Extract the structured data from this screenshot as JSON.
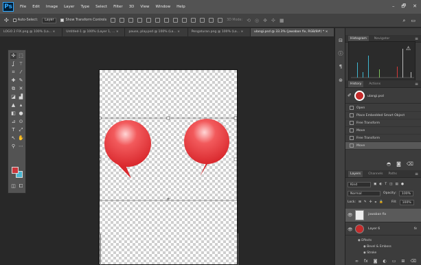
{
  "app": {
    "logo": "Ps",
    "menus": [
      "File",
      "Edit",
      "Image",
      "Layer",
      "Type",
      "Select",
      "Filter",
      "3D",
      "View",
      "Window",
      "Help"
    ],
    "window_controls": [
      "–",
      "🗗",
      "✕"
    ]
  },
  "options": {
    "auto_select": "Auto-Select:",
    "layer_select": "Layer",
    "show_transform": "Show Transform Controls",
    "mode_3d": "3D Mode:"
  },
  "tabs": [
    {
      "label": "LOGO 2 FIX.png @ 100% (La...",
      "close": "×"
    },
    {
      "label": "Untitled-1 @ 100% (Layer 1, ...",
      "close": "×"
    },
    {
      "label": "pause, play.psd @ 100% (La...",
      "close": "×"
    },
    {
      "label": "Pengaturan.png @ 100% (La...",
      "close": "×"
    },
    {
      "label": "ulangi.psd @ 33.3% (jawaban fix, RGB/8#) *",
      "close": "×"
    }
  ],
  "colors": {
    "bubble": "#e8353a",
    "foreground": "#c9363b",
    "background": "#4ab6d1"
  },
  "histogram_panel": {
    "tabs": [
      "Histogram",
      "Navigator"
    ],
    "warning": "⚠"
  },
  "history_panel": {
    "tabs": [
      "History",
      "Actions"
    ],
    "snapshot": "ulangi.psd",
    "items": [
      "Open",
      "Place Embedded Smart Object",
      "Free Transform",
      "Move",
      "Free Transform",
      "Move"
    ]
  },
  "layers_panel": {
    "tabs": [
      "Layers",
      "Channels",
      "Paths"
    ],
    "kind": "Kind",
    "blend": "Normal",
    "opacity_label": "Opacity:",
    "opacity": "100%",
    "lock_label": "Lock:",
    "fill_label": "Fill:",
    "fill": "100%",
    "layers": [
      {
        "name": "jawaban fix",
        "thumb": "white"
      },
      {
        "name": "Layer 6",
        "fx": "fx",
        "thumb": "red"
      }
    ],
    "effects_label": "Effects",
    "effects": [
      "Bevel & Emboss",
      "Stroke"
    ]
  }
}
